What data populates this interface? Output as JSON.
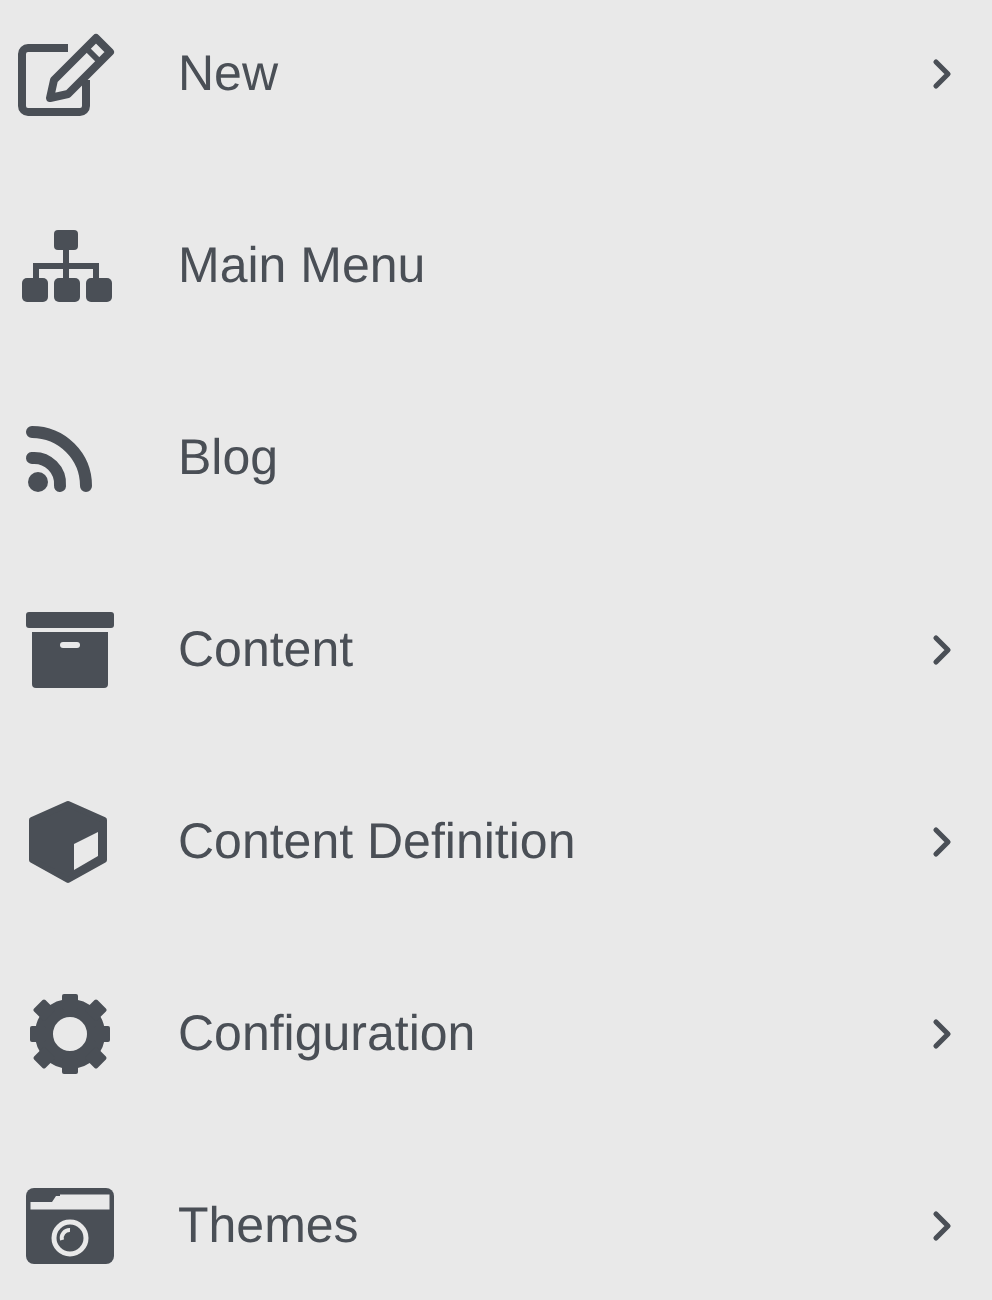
{
  "menu": {
    "items": [
      {
        "label": "New",
        "has_submenu": true
      },
      {
        "label": "Main Menu",
        "has_submenu": false
      },
      {
        "label": "Blog",
        "has_submenu": false
      },
      {
        "label": "Content",
        "has_submenu": true
      },
      {
        "label": "Content Definition",
        "has_submenu": true
      },
      {
        "label": "Configuration",
        "has_submenu": true
      },
      {
        "label": "Themes",
        "has_submenu": true
      }
    ]
  }
}
